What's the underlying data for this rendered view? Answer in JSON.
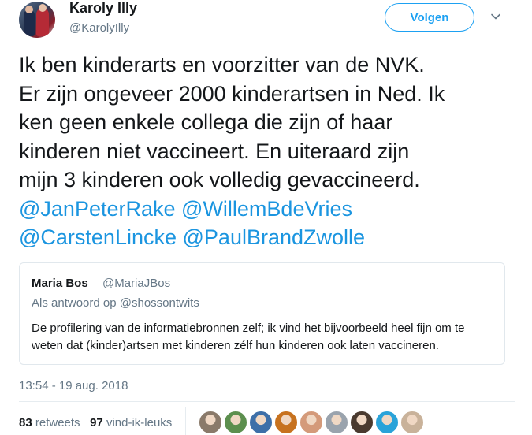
{
  "author": {
    "display_name": "Karoly Illy",
    "handle": "@KarolyIlly",
    "avatar": "user-avatar-photo"
  },
  "follow_button": {
    "label": "Volgen"
  },
  "menu": {
    "icon": "chevron-down-icon"
  },
  "tweet": {
    "lines": [
      "Ik ben kinderarts en voorzitter van de NVK.",
      "Er zijn ongeveer 2000 kinderartsen in Ned. Ik",
      "ken geen enkele collega die zijn of haar",
      "kinderen niet vaccineert. En uiteraard zijn",
      "mijn 3 kinderen ook volledig gevaccineerd."
    ],
    "mentions": [
      "@JanPeterRake",
      "@WillemBdeVries",
      "@CarstenLincke",
      "@PaulBrandZwolle"
    ]
  },
  "quoted_tweet": {
    "name": "Maria Bos",
    "handle": "@MariaJBos",
    "reply_prefix": "Als antwoord op",
    "reply_to": "@shossontwits",
    "text_lines": [
      "De profilering van de informatiebronnen zelf; ik vind het bijvoorbeeld heel fijn om te",
      "weten dat (kinder)artsen met kinderen zélf hun kinderen ook laten vaccineren."
    ]
  },
  "timestamp": "13:54 - 19 aug. 2018",
  "stats": {
    "retweets_count": "83",
    "retweets_label": "retweets",
    "likes_count": "97",
    "likes_label": "vind-ik-leuks"
  },
  "likers": [
    {
      "color": "#8a7a6a"
    },
    {
      "color": "#5c8f4e"
    },
    {
      "color": "#3d6fa8"
    },
    {
      "color": "#c7721f"
    },
    {
      "color": "#d49a7a"
    },
    {
      "color": "#9aa3ad"
    },
    {
      "color": "#4a3a2f"
    },
    {
      "color": "#2aa3d9"
    },
    {
      "color": "#c9b29a"
    }
  ],
  "colors": {
    "accent": "#1da1f2",
    "mention": "#1b95e0",
    "secondary_text": "#657786",
    "border": "#e1e8ed"
  }
}
